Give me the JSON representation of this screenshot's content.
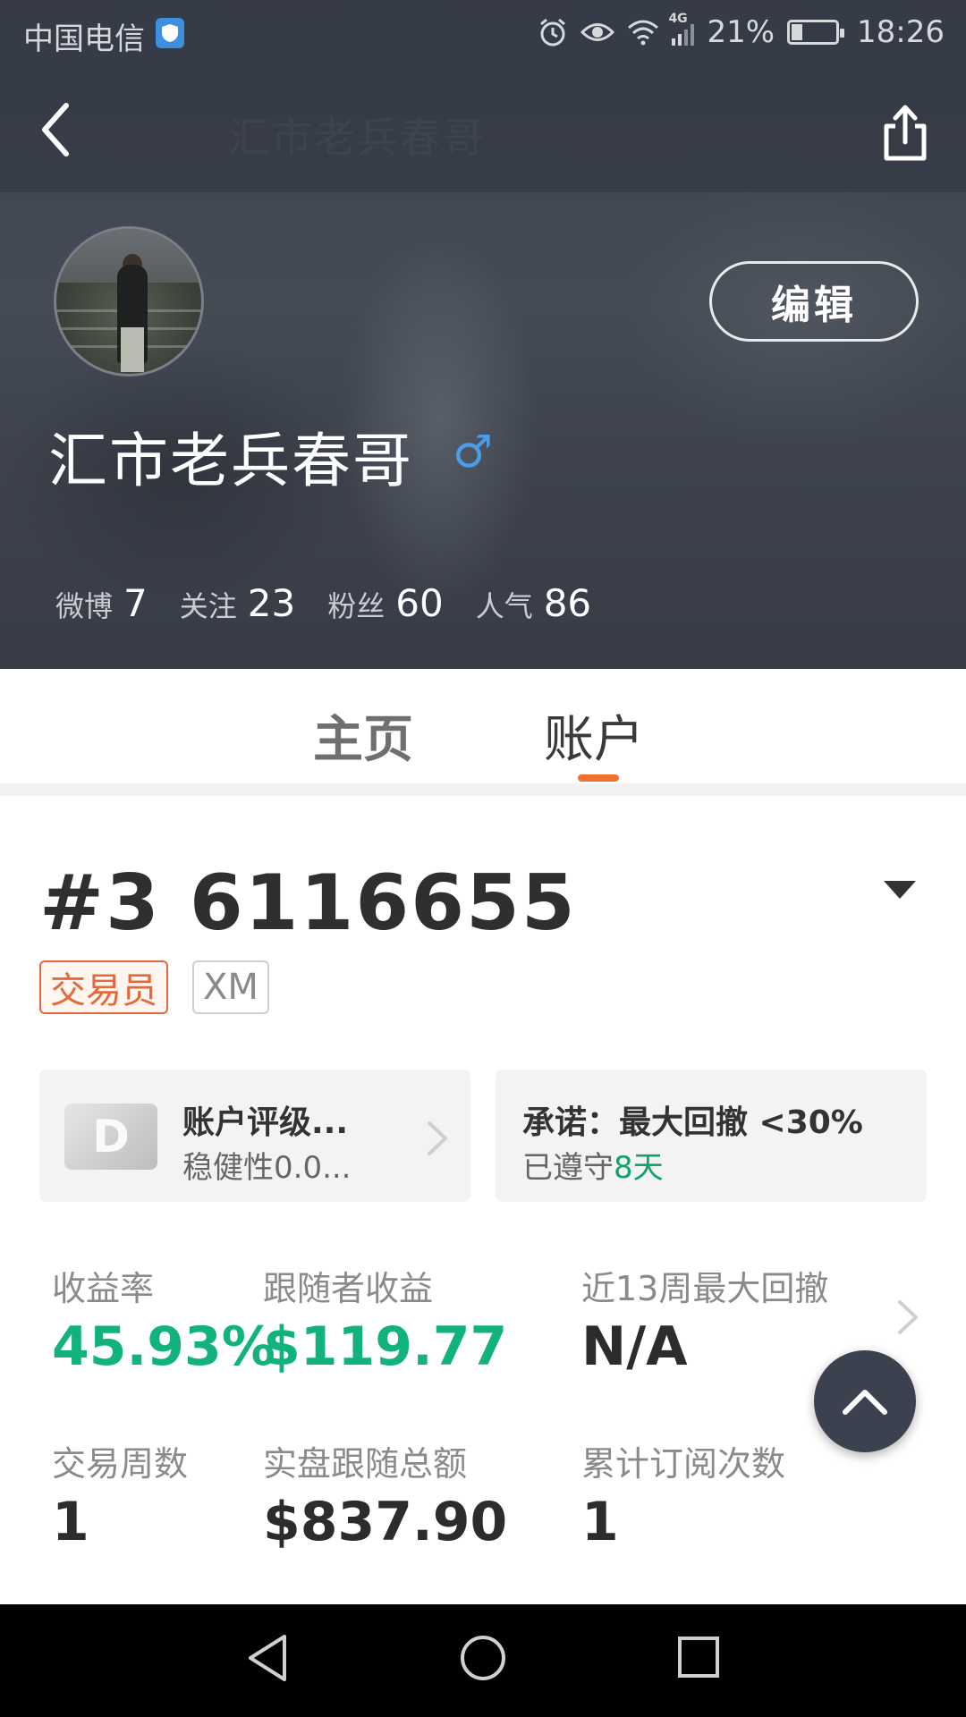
{
  "status_bar": {
    "carrier": "中国电信",
    "network": "4G",
    "battery": "21%",
    "time": "18:26"
  },
  "nav": {
    "ghost_title": "汇市老兵春哥"
  },
  "profile": {
    "edit_label": "编辑",
    "username": "汇市老兵春哥",
    "gender_symbol": "♂",
    "stats": [
      {
        "label": "微博",
        "value": "7"
      },
      {
        "label": "关注",
        "value": "23"
      },
      {
        "label": "粉丝",
        "value": "60"
      },
      {
        "label": "人气",
        "value": "86"
      }
    ]
  },
  "tabs": [
    {
      "label": "主页",
      "active": false
    },
    {
      "label": "账户",
      "active": true
    }
  ],
  "account": {
    "id": "#3 6116655",
    "tags": [
      "交易员",
      "XM"
    ],
    "rating_card": {
      "badge": "D",
      "title": "账户评级...",
      "subtitle": "稳健性0.0..."
    },
    "promise_card": {
      "title": "承诺：最大回撤 <30%",
      "subtitle_prefix": "已遵守",
      "subtitle_days": "8天"
    },
    "metrics": [
      {
        "label": "收益率",
        "value": "45.93%"
      },
      {
        "label": "跟随者收益",
        "value": "$119.77"
      },
      {
        "label": "近13周最大回撤",
        "value": "N/A"
      },
      {
        "label": "交易周数",
        "value": "1"
      },
      {
        "label": "实盘跟随总额",
        "value": "$837.90"
      },
      {
        "label": "累计订阅次数",
        "value": "1"
      }
    ]
  },
  "colors": {
    "accent_orange": "#f07030",
    "green": "#12b37a",
    "gender_blue": "#4a9de8",
    "header_bg": "#404652"
  },
  "icons": [
    "back-arrow-icon",
    "share-icon",
    "dropdown-triangle-icon",
    "chevron-right-icon",
    "scroll-top-icon",
    "nav-back-icon",
    "nav-home-icon",
    "nav-recent-icon"
  ]
}
